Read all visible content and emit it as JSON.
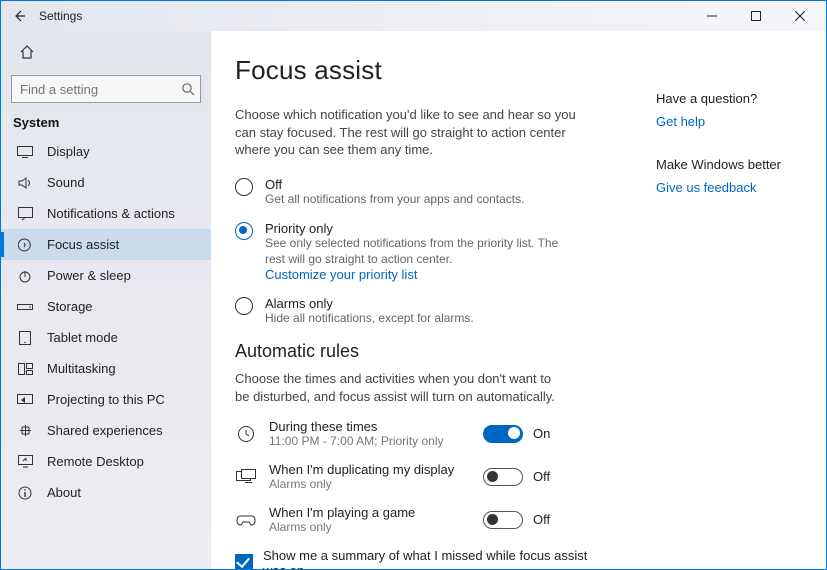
{
  "titlebar": {
    "title": "Settings"
  },
  "search": {
    "placeholder": "Find a setting"
  },
  "sidebar": {
    "heading": "System",
    "items": [
      {
        "label": "Display"
      },
      {
        "label": "Sound"
      },
      {
        "label": "Notifications & actions"
      },
      {
        "label": "Focus assist"
      },
      {
        "label": "Power & sleep"
      },
      {
        "label": "Storage"
      },
      {
        "label": "Tablet mode"
      },
      {
        "label": "Multitasking"
      },
      {
        "label": "Projecting to this PC"
      },
      {
        "label": "Shared experiences"
      },
      {
        "label": "Remote Desktop"
      },
      {
        "label": "About"
      }
    ]
  },
  "page": {
    "title": "Focus assist",
    "description": "Choose which notification you'd like to see and hear so you can stay focused. The rest will go straight to action center where you can see them any time.",
    "radios": {
      "off": {
        "title": "Off",
        "sub": "Get all notifications from your apps and contacts."
      },
      "priority": {
        "title": "Priority only",
        "sub": "See only selected notifications from the priority list. The rest will go straight to action center.",
        "link": "Customize your priority list"
      },
      "alarms": {
        "title": "Alarms only",
        "sub": "Hide all notifications, except for alarms."
      }
    },
    "rules": {
      "heading": "Automatic rules",
      "desc": "Choose the times and activities when you don't want to be disturbed, and focus assist will turn on automatically.",
      "times": {
        "title": "During these times",
        "sub": "11:00 PM - 7:00 AM; Priority only",
        "state": "On"
      },
      "duplicate": {
        "title": "When I'm duplicating my display",
        "sub": "Alarms only",
        "state": "Off"
      },
      "game": {
        "title": "When I'm playing a game",
        "sub": "Alarms only",
        "state": "Off"
      }
    },
    "summary_checkbox": "Show me a summary of what I missed while focus assist was on"
  },
  "rail": {
    "question_heading": "Have a question?",
    "help_link": "Get help",
    "feedback_heading": "Make Windows better",
    "feedback_link": "Give us feedback"
  }
}
